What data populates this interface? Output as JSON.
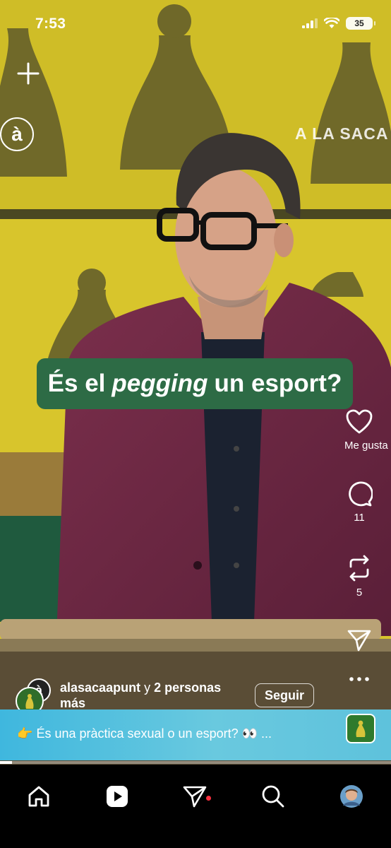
{
  "status_bar": {
    "time": "7:53",
    "battery": "35"
  },
  "overlay": {
    "channel_logo": "à",
    "show_brand": "A LA SACA"
  },
  "caption": {
    "prefix": "És el",
    "emphasis": "pegging",
    "suffix": "un esport?"
  },
  "actions": {
    "like_label": "Me gusta",
    "comments_count": "11",
    "reposts_count": "5"
  },
  "author": {
    "avatar_letter": "à",
    "username": "alasacaapunt",
    "connector": "y",
    "others": "2 personas",
    "others_tail": "más",
    "follow_label": "Seguir"
  },
  "description": {
    "emoji_lead": "👉",
    "text": "És una pràctica sexual o un esport? 👀 ..."
  },
  "playback": {
    "progress_fraction": 0.03
  },
  "colors": {
    "caption_bg": "#2d6b45",
    "notify_dot": "#ff3040",
    "desc_strip": "#5ec2dc"
  },
  "bottom_nav": [
    "home-icon",
    "reels-icon",
    "direct-send-icon",
    "search-icon",
    "profile-avatar"
  ]
}
